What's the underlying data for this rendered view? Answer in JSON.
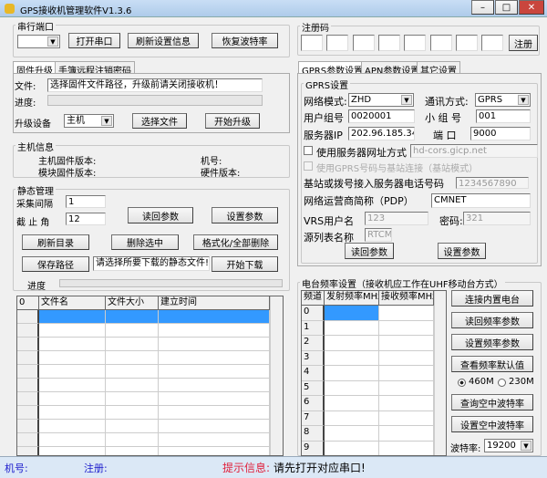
{
  "window": {
    "title": "GPS接收机管理软件V1.3.6",
    "icon": "app-icon"
  },
  "serial": {
    "group_label": "串行端口",
    "port_value": "",
    "open_button": "打开串口",
    "refresh_button": "刷新设置信息",
    "restore_button": "恢复波特率"
  },
  "left_tabs": [
    {
      "label": "固件升级",
      "active": true
    },
    {
      "label": "手簿远程注销密码",
      "active": false
    }
  ],
  "firmware": {
    "file_label": "文件:",
    "file_value": "选择固件文件路径，升级前请关闭接收机！",
    "progress_label": "进度:",
    "progress": 0,
    "device_label": "升级设备",
    "device_value": "主机",
    "select_file_button": "选择文件",
    "start_upgrade_button": "开始升级"
  },
  "host_info": {
    "group_label": "主机信息",
    "host_fw": "主机固件版本:",
    "module_fw": "模块固件版本:",
    "machine_no": "机号:",
    "hw_version": "硬件版本:"
  },
  "static": {
    "group_label": "静态管理",
    "interval_label": "采集间隔",
    "interval_value": "1",
    "cutoff_label": "截 止 角",
    "cutoff_value": "12",
    "read_button": "读回参数",
    "set_button": "设置参数",
    "refresh_dir_button": "刷新目录",
    "delete_selected_button": "删除选中",
    "format_button": "格式化/全部删除",
    "save_path_button": "保存路径",
    "hint_value": "请选择所要下载的静态文件!",
    "start_download_button": "开始下载",
    "progress_label": "进度",
    "progress": 0,
    "table": {
      "columns": [
        "0",
        "文件名",
        "文件大小",
        "建立时间"
      ],
      "rows": 11
    }
  },
  "register": {
    "group_label": "注册码",
    "codes": [
      "",
      "",
      "",
      "",
      "",
      "",
      "",
      ""
    ],
    "button": "注册"
  },
  "right_tabs": [
    {
      "label": "GPRS参数设置",
      "active": true
    },
    {
      "label": "APN参数设置",
      "active": false
    },
    {
      "label": "其它设置",
      "active": false
    }
  ],
  "gprs": {
    "group_label": "GPRS设置",
    "net_mode_label": "网络模式:",
    "net_mode_value": "ZHD",
    "comm_label": "通讯方式:",
    "comm_value": "GPRS",
    "user_group_label": "用户组号",
    "user_group_value": "0020001",
    "sub_group_label": "小 组 号",
    "sub_group_value": "001",
    "server_ip_label": "服务器IP",
    "server_ip_value": "202.96.185.34",
    "port_label": "端 口",
    "port_value": "9000",
    "use_url_label": "使用服务器网址方式",
    "use_url_checked": false,
    "url_value": "hd-cors.gicp.net",
    "disabled_option_label": "使用GPRS号码与基站连接（基站模式）",
    "phone_label": "基站或拨号接入服务器电话号码",
    "phone_value": "1234567890",
    "pdp_label": "网络运营商简称（PDP）",
    "pdp_value": "CMNET",
    "vrs_user_label": "VRS用户名",
    "vrs_user_value": "123",
    "password_label": "密码:",
    "password_value": "321",
    "source_label": "源列表名称",
    "source_value": "RTCM",
    "read_button": "读回参数",
    "set_button": "设置参数"
  },
  "radio": {
    "group_label": "电台频率设置（接收机应工作在UHF移动台方式）",
    "columns": [
      "频道",
      "发射频率MHz",
      "接收频率MHz"
    ],
    "channels": [
      "0",
      "1",
      "2",
      "3",
      "4",
      "5",
      "6",
      "7",
      "8",
      "9"
    ],
    "connect_button": "连接内置电台",
    "read_button": "读回频率参数",
    "set_button": "设置频率参数",
    "default_button": "查看频率默认值",
    "band_options": [
      "460M",
      "230M"
    ],
    "band_selected": "460M",
    "query_baud_button": "查询空中波特率",
    "set_baud_button": "设置空中波特率",
    "baud_label": "波特率:",
    "baud_value": "19200"
  },
  "status": {
    "machine_label": "机号:",
    "register_label": "注册:",
    "hint_label": "提示信息:",
    "hint_text": "请先打开对应串口!",
    "colors": {
      "label": "#1a1acc",
      "hint": "#e0203c"
    }
  }
}
